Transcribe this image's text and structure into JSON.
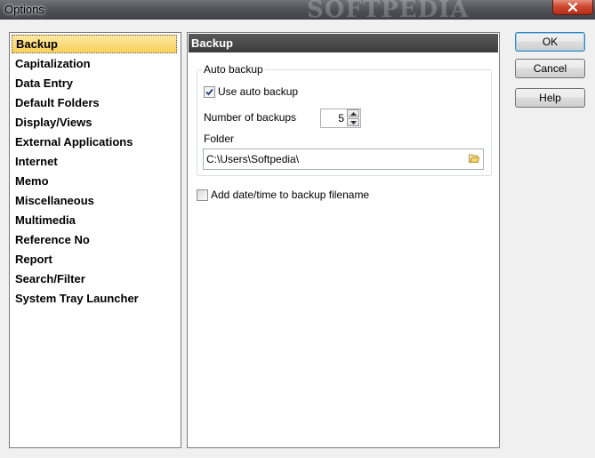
{
  "window": {
    "title": "Options",
    "watermark": "SOFTPEDIA"
  },
  "nav": {
    "items": [
      {
        "label": "Backup",
        "selected": true
      },
      {
        "label": "Capitalization"
      },
      {
        "label": "Data Entry"
      },
      {
        "label": "Default Folders"
      },
      {
        "label": "Display/Views"
      },
      {
        "label": "External Applications"
      },
      {
        "label": "Internet"
      },
      {
        "label": "Memo"
      },
      {
        "label": "Miscellaneous"
      },
      {
        "label": "Multimedia"
      },
      {
        "label": "Reference No"
      },
      {
        "label": "Report"
      },
      {
        "label": "Search/Filter"
      },
      {
        "label": "System Tray Launcher"
      }
    ]
  },
  "backup": {
    "header": "Backup",
    "group_title": "Auto backup",
    "use_auto_backup": {
      "label": "Use auto backup",
      "checked": true
    },
    "number_of_backups": {
      "label": "Number of backups",
      "value": "5"
    },
    "folder": {
      "label": "Folder",
      "value": "C:\\Users\\Softpedia\\"
    },
    "add_datetime": {
      "label": "Add date/time to backup filename",
      "checked": false
    }
  },
  "buttons": {
    "ok": "OK",
    "cancel": "Cancel",
    "help": "Help"
  },
  "colors": {
    "selection": "#f9cf57",
    "header_bar": "#3c3c3c",
    "close": "#c9432c"
  }
}
